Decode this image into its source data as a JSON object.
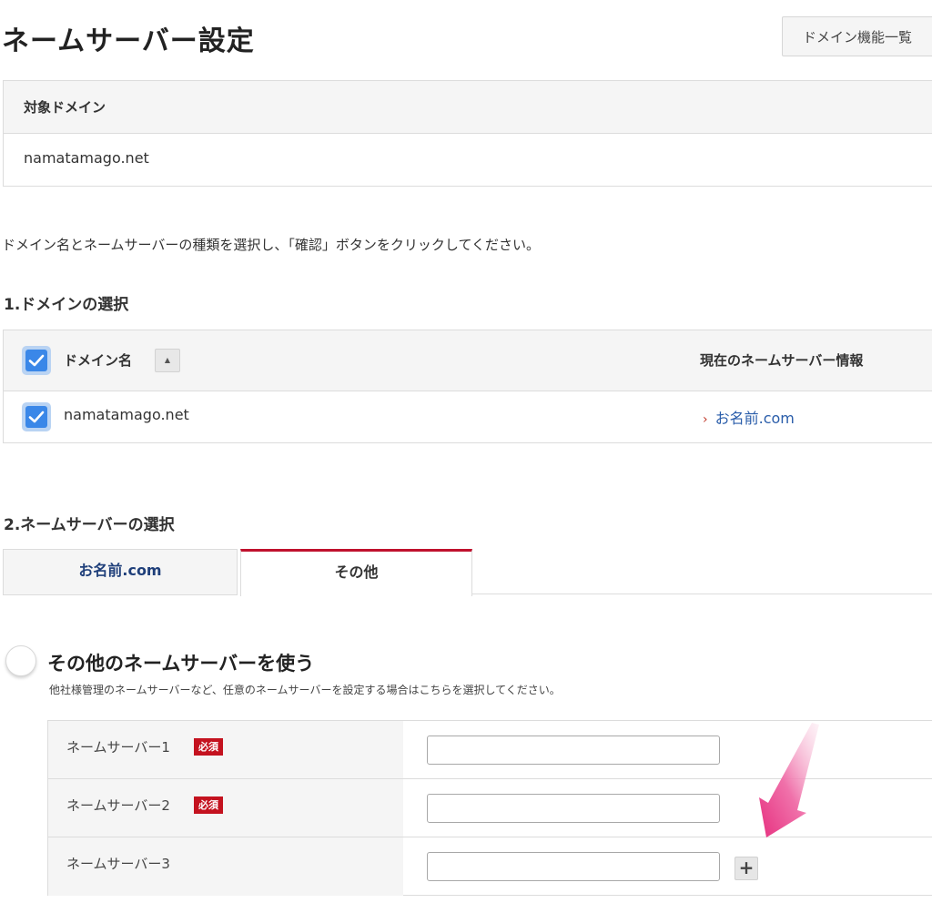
{
  "page_title": "ネームサーバー設定",
  "function_list_button": "ドメイン機能一覧",
  "target_domain": {
    "header": "対象ドメイン",
    "value": "namatamago.net"
  },
  "intro_text": "ドメイン名とネームサーバーの種類を選択し、「確認」ボタンをクリックしてください。",
  "section1": {
    "title": "1.ドメインの選択",
    "table": {
      "col_domain": "ドメイン名",
      "sort_symbol": "▲",
      "col_ns_info": "現在のネームサーバー情報",
      "rows": [
        {
          "domain": "namatamago.net",
          "ns_info": "お名前.com",
          "checked": true
        }
      ]
    }
  },
  "section2": {
    "title": "2.ネームサーバーの選択",
    "tabs": [
      {
        "label": "お名前.com",
        "active": false
      },
      {
        "label": "その他",
        "active": true
      }
    ],
    "option": {
      "title": "その他のネームサーバーを使う",
      "description": "他社様管理のネームサーバーなど、任意のネームサーバーを設定する場合はこちらを選択してください。"
    },
    "nameservers": [
      {
        "label": "ネームサーバー1",
        "required_badge": "必須",
        "value": ""
      },
      {
        "label": "ネームサーバー2",
        "required_badge": "必須",
        "value": ""
      },
      {
        "label": "ネームサーバー3",
        "value": ""
      }
    ],
    "add_symbol": "+"
  },
  "colors": {
    "accent_red": "#c0112d",
    "checkbox_blue": "#3a87e8",
    "link_blue": "#2a5daa",
    "annotation_arrow": "#ea3f86"
  }
}
